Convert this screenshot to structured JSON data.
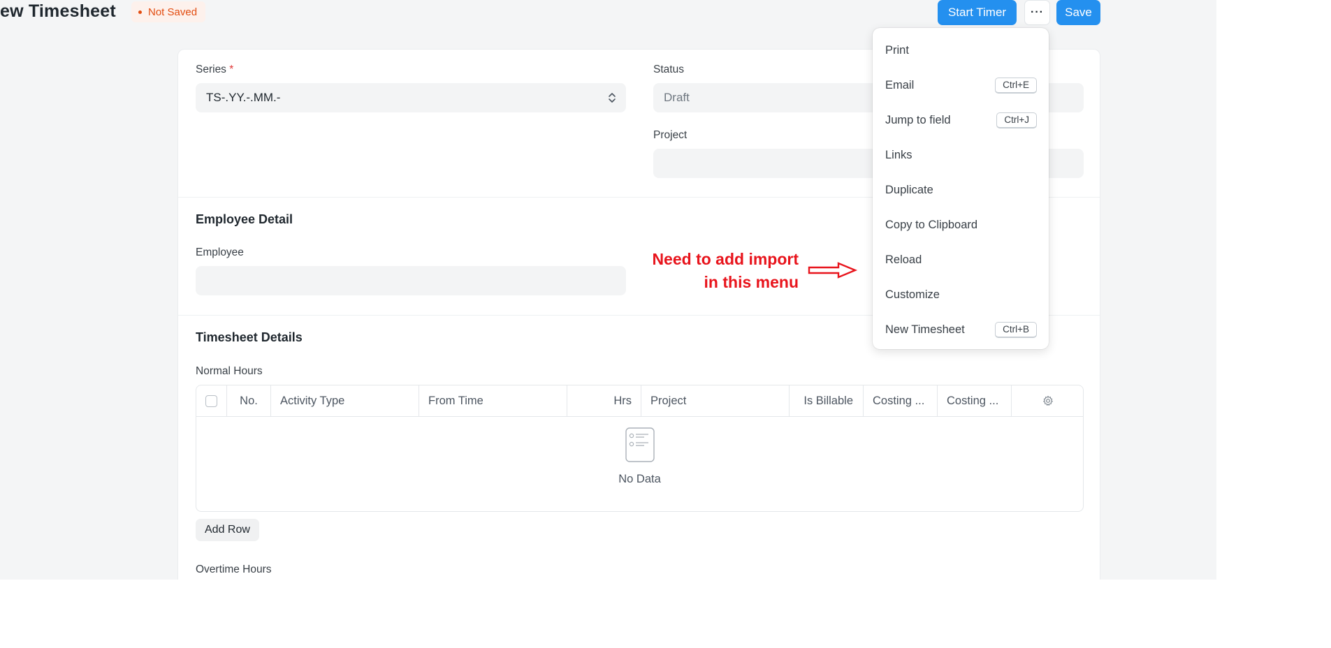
{
  "header": {
    "title": "ew Timesheet",
    "status": "Not Saved",
    "start_timer_label": "Start Timer",
    "more_label": "···",
    "save_label": "Save"
  },
  "form": {
    "series": {
      "label": "Series",
      "required_mark": "*",
      "value": "TS-.YY.-.MM.-"
    },
    "status": {
      "label": "Status",
      "value": "Draft"
    },
    "project": {
      "label": "Project",
      "value": ""
    }
  },
  "employee_section": {
    "title": "Employee Detail",
    "employee_label": "Employee",
    "employee_value": ""
  },
  "timesheet_section": {
    "title": "Timesheet Details",
    "normal_hours_label": "Normal Hours",
    "columns": [
      "No.",
      "Activity Type",
      "From Time",
      "Hrs",
      "Project",
      "Is Billable",
      "Costing ...",
      "Costing ..."
    ],
    "empty_text": "No Data",
    "add_row_label": "Add Row",
    "overtime_label": "Overtime Hours"
  },
  "menu": {
    "items": [
      {
        "label": "Print",
        "shortcut": ""
      },
      {
        "label": "Email",
        "shortcut": "Ctrl+E"
      },
      {
        "label": "Jump to field",
        "shortcut": "Ctrl+J"
      },
      {
        "label": "Links",
        "shortcut": ""
      },
      {
        "label": "Duplicate",
        "shortcut": ""
      },
      {
        "label": "Copy to Clipboard",
        "shortcut": ""
      },
      {
        "label": "Reload",
        "shortcut": ""
      },
      {
        "label": "Customize",
        "shortcut": ""
      },
      {
        "label": "New Timesheet",
        "shortcut": "Ctrl+B"
      }
    ]
  },
  "annotation": {
    "line1": "Need to add import",
    "line2": "in this menu",
    "color": "#e8141c"
  },
  "colors": {
    "primary": "#2490ef",
    "indicator": "#e24c10",
    "background": "#f4f5f6"
  }
}
